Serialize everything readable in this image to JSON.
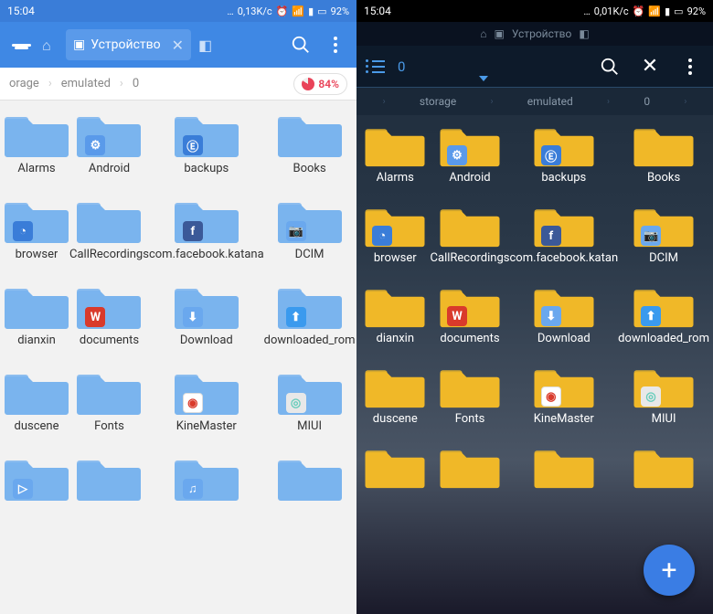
{
  "status": {
    "time": "15:04",
    "speed_left": "0,13K/c",
    "speed_right": "0,01K/c",
    "battery": "92%"
  },
  "left": {
    "tab_label": "Устройство",
    "breadcrumb": [
      "orage",
      "emulated",
      "0"
    ],
    "storage_badge": "84%",
    "folders": [
      {
        "name": "Alarms",
        "overlay": null
      },
      {
        "name": "Android",
        "overlay": "gear"
      },
      {
        "name": "backups",
        "overlay": "es"
      },
      {
        "name": "Books",
        "overlay": null
      },
      {
        "name": "browser",
        "overlay": "browser"
      },
      {
        "name": "CallRecordings",
        "overlay": null
      },
      {
        "name": "com.facebook.katana",
        "overlay": "fb"
      },
      {
        "name": "DCIM",
        "overlay": "cam"
      },
      {
        "name": "dianxin",
        "overlay": null
      },
      {
        "name": "documents",
        "overlay": "wps"
      },
      {
        "name": "Download",
        "overlay": "dl"
      },
      {
        "name": "downloaded_rom",
        "overlay": "up"
      },
      {
        "name": "duscene",
        "overlay": null
      },
      {
        "name": "Fonts",
        "overlay": null
      },
      {
        "name": "KineMaster",
        "overlay": "km"
      },
      {
        "name": "MIUI",
        "overlay": "miui"
      },
      {
        "name": "",
        "overlay": "play"
      },
      {
        "name": "",
        "overlay": null
      },
      {
        "name": "",
        "overlay": "music"
      },
      {
        "name": "",
        "overlay": null
      }
    ]
  },
  "right": {
    "path_label": "Устройство",
    "selection_count": "0",
    "breadcrumb": [
      "storage",
      "emulated",
      "0"
    ],
    "folders": [
      {
        "name": "Alarms",
        "overlay": null
      },
      {
        "name": "Android",
        "overlay": "gear"
      },
      {
        "name": "backups",
        "overlay": "es"
      },
      {
        "name": "Books",
        "overlay": null
      },
      {
        "name": "browser",
        "overlay": "browser"
      },
      {
        "name": "CallRecordings",
        "overlay": null
      },
      {
        "name": "com.facebook.katan",
        "overlay": "fb"
      },
      {
        "name": "DCIM",
        "overlay": "cam"
      },
      {
        "name": "dianxin",
        "overlay": null
      },
      {
        "name": "documents",
        "overlay": "wps"
      },
      {
        "name": "Download",
        "overlay": "dl"
      },
      {
        "name": "downloaded_rom",
        "overlay": "up"
      },
      {
        "name": "duscene",
        "overlay": null
      },
      {
        "name": "Fonts",
        "overlay": null
      },
      {
        "name": "KineMaster",
        "overlay": "km"
      },
      {
        "name": "MIUI",
        "overlay": "miui"
      },
      {
        "name": "",
        "overlay": null
      },
      {
        "name": "",
        "overlay": null
      },
      {
        "name": "",
        "overlay": null
      },
      {
        "name": "",
        "overlay": null
      }
    ]
  },
  "overlay_glyphs": {
    "gear": "⚙",
    "es": "Ⓔ",
    "browser": "◔",
    "fb": "f",
    "cam": "📷",
    "wps": "W",
    "dl": "⬇",
    "up": "⬆",
    "km": "◉",
    "miui": "◎",
    "play": "▷",
    "music": "♫"
  }
}
